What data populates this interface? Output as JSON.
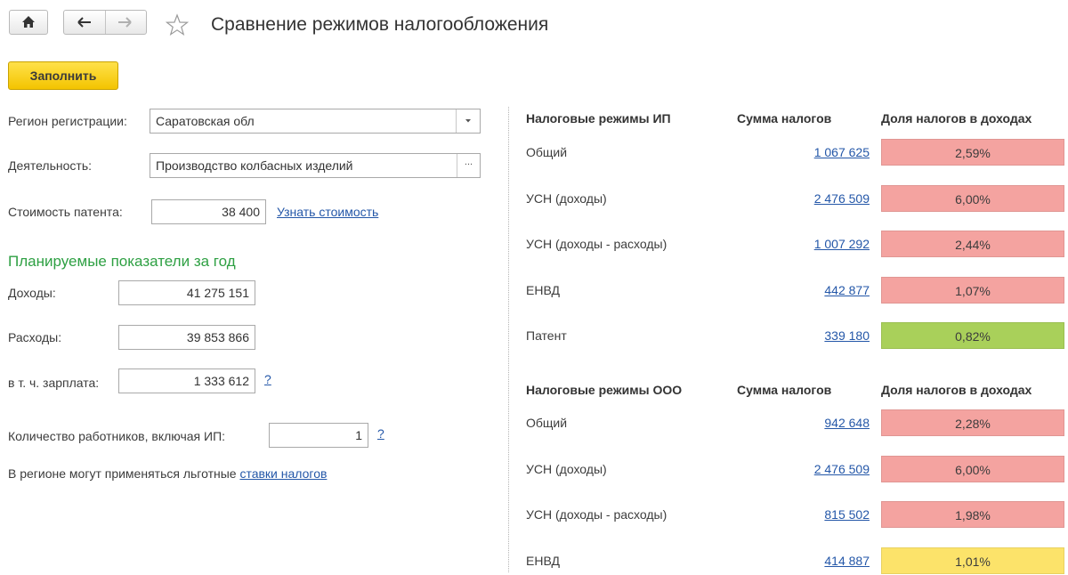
{
  "title": "Сравнение режимов налогообложения",
  "toolbar": {
    "fill_label": "Заполнить"
  },
  "form": {
    "region_label": "Регион регистрации:",
    "region_value": "Саратовская обл",
    "activity_label": "Деятельность:",
    "activity_value": "Производство колбасных изделий",
    "activity_btn": "...",
    "patent_label": "Стоимость патента:",
    "patent_value": "38 400",
    "patent_link": "Узнать стоимость",
    "planned_title": "Планируемые показатели за год",
    "income_label": "Доходы:",
    "income_value": "41 275 151",
    "expense_label": "Расходы:",
    "expense_value": "39 853 866",
    "salary_label": "в т. ч. зарплата:",
    "salary_value": "1 333 612",
    "help_mark": "?",
    "workers_label": "Количество работников, включая ИП:",
    "workers_value": "1",
    "region_note": "В регионе могут применяться льготные",
    "region_note_link": "ставки налогов"
  },
  "ip_table": {
    "headers": [
      "Налоговые режимы ИП",
      "Сумма налогов",
      "Доля налогов в доходах"
    ],
    "rows": [
      {
        "name": "Общий",
        "amount": "1 067 625",
        "share": "2,59%",
        "color": "#f4a3a0"
      },
      {
        "name": "УСН (доходы)",
        "amount": "2 476 509",
        "share": "6,00%",
        "color": "#f4a3a0"
      },
      {
        "name": "УСН (доходы - расходы)",
        "amount": "1 007 292",
        "share": "2,44%",
        "color": "#f4a3a0"
      },
      {
        "name": "ЕНВД",
        "amount": "442 877",
        "share": "1,07%",
        "color": "#f4a3a0"
      },
      {
        "name": "Патент",
        "amount": "339 180",
        "share": "0,82%",
        "color": "#a9d05a"
      }
    ]
  },
  "ooo_table": {
    "headers": [
      "Налоговые режимы ООО",
      "Сумма налогов",
      "Доля налогов в доходах"
    ],
    "rows": [
      {
        "name": "Общий",
        "amount": "942 648",
        "share": "2,28%",
        "color": "#f4a3a0"
      },
      {
        "name": "УСН (доходы)",
        "amount": "2 476 509",
        "share": "6,00%",
        "color": "#f4a3a0"
      },
      {
        "name": "УСН (доходы - расходы)",
        "amount": "815 502",
        "share": "1,98%",
        "color": "#f4a3a0"
      },
      {
        "name": "ЕНВД",
        "amount": "414 887",
        "share": "1,01%",
        "color": "#fce36a"
      }
    ]
  }
}
